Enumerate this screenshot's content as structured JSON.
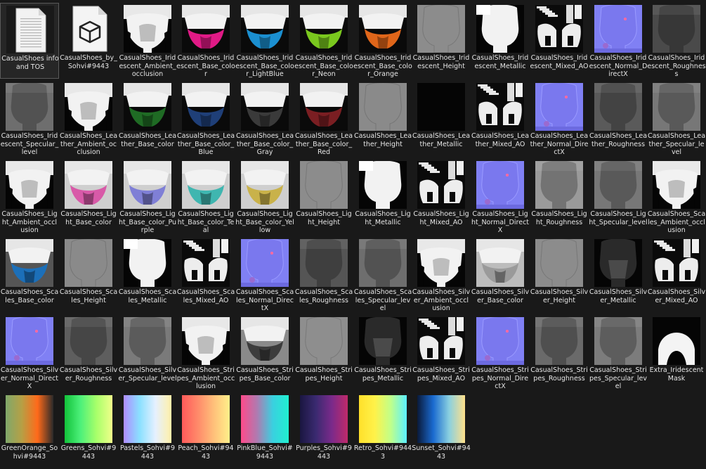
{
  "explorer": {
    "items": [
      {
        "name": "CasualShoes info and TOS",
        "thumb": "document-icon"
      },
      {
        "name": "CasualShoes_by_Sohvi#9443",
        "thumb": "3d-object-icon"
      },
      {
        "name": "CasualShoes_Iridescent_Ambient_occlusion",
        "thumb": "ao"
      },
      {
        "name": "CasualShoes_Iridescent_Base_color",
        "thumb": "base",
        "color": "#e01a86"
      },
      {
        "name": "CasualShoes_Iridescent_Base_color_LightBlue",
        "thumb": "base",
        "color": "#1b8fd0"
      },
      {
        "name": "CasualShoes_Iridescent_Base_color_Neon",
        "thumb": "base",
        "color": "#7ac81e"
      },
      {
        "name": "CasualShoes_Iridescent_Base_color_Orange",
        "thumb": "base",
        "color": "#e0661a"
      },
      {
        "name": "CasualShoes_Iridescent_Height",
        "thumb": "flat",
        "color": "#8c8c8c"
      },
      {
        "name": "CasualShoes_Iridescent_Metallic",
        "thumb": "metallic"
      },
      {
        "name": "CasualShoes_Iridescent_Mixed_AO",
        "thumb": "mixed"
      },
      {
        "name": "CasualShoes_Iridescent_Normal_DirectX",
        "thumb": "normal"
      },
      {
        "name": "CasualShoes_Iridescent_Roughness",
        "thumb": "gray",
        "color": "#4a4a4a"
      },
      {
        "name": "CasualShoes_Iridescent_Specular_level",
        "thumb": "gray",
        "color": "#6e6e6e"
      },
      {
        "name": "CasualShoes_Leather_Ambient_occlusion",
        "thumb": "ao"
      },
      {
        "name": "CasualShoes_Leather_Base_color",
        "thumb": "base",
        "color": "#1f6b24"
      },
      {
        "name": "CasualShoes_Leather_Base_color_Blue",
        "thumb": "base",
        "color": "#1f3f78"
      },
      {
        "name": "CasualShoes_Leather_Base_color_Gray",
        "thumb": "base",
        "color": "#3a3a3a"
      },
      {
        "name": "CasualShoes_Leather_Base_color_Red",
        "thumb": "base",
        "color": "#7a1e22"
      },
      {
        "name": "CasualShoes_Leather_Height",
        "thumb": "flat",
        "color": "#8a8a8a"
      },
      {
        "name": "CasualShoes_Leather_Metallic",
        "thumb": "black"
      },
      {
        "name": "CasualShoes_Leather_Mixed_AO",
        "thumb": "mixed"
      },
      {
        "name": "CasualShoes_Leather_Normal_DirectX",
        "thumb": "normal"
      },
      {
        "name": "CasualShoes_Leather_Roughness",
        "thumb": "gray",
        "color": "#5a5a5a"
      },
      {
        "name": "CasualShoes_Leather_Specular_level",
        "thumb": "gray",
        "color": "#777777"
      },
      {
        "name": "CasualShoes_Light_Ambient_occlusion",
        "thumb": "ao"
      },
      {
        "name": "CasualShoes_Light_Base_color",
        "thumb": "base",
        "color": "#d85aa8",
        "bg": "#cfcfcf"
      },
      {
        "name": "CasualShoes_Light_Base_color_Purple",
        "thumb": "base",
        "color": "#7f7fd6",
        "bg": "#cfcfcf"
      },
      {
        "name": "CasualShoes_Light_Base_color_Teal",
        "thumb": "base",
        "color": "#3fb6b0",
        "bg": "#cfcfcf"
      },
      {
        "name": "CasualShoes_Light_Base_color_Yellow",
        "thumb": "base",
        "color": "#c9b24a",
        "bg": "#cfcfcf"
      },
      {
        "name": "CasualShoes_Light_Height",
        "thumb": "flat",
        "color": "#8c8c8c"
      },
      {
        "name": "CasualShoes_Light_Metallic",
        "thumb": "metallic"
      },
      {
        "name": "CasualShoes_Light_Mixed_AO",
        "thumb": "mixed"
      },
      {
        "name": "CasualShoes_Light_Normal_DirectX",
        "thumb": "normal"
      },
      {
        "name": "CasualShoes_Light_Roughness",
        "thumb": "gray",
        "color": "#9a9a9a"
      },
      {
        "name": "CasualShoes_Light_Specular_level",
        "thumb": "gray",
        "color": "#777777"
      },
      {
        "name": "CasualShoes_Scales_Ambient_occlusion",
        "thumb": "ao"
      },
      {
        "name": "CasualShoes_Scales_Base_color",
        "thumb": "base",
        "color": "#1c6fb8",
        "bg": "#555555"
      },
      {
        "name": "CasualShoes_Scales_Height",
        "thumb": "flat",
        "color": "#8a8a8a"
      },
      {
        "name": "CasualShoes_Scales_Metallic",
        "thumb": "metallic"
      },
      {
        "name": "CasualShoes_Scales_Mixed_AO",
        "thumb": "mixed"
      },
      {
        "name": "CasualShoes_Scales_Normal_DirectX",
        "thumb": "normal"
      },
      {
        "name": "CasualShoes_Scales_Roughness",
        "thumb": "gray",
        "color": "#555555"
      },
      {
        "name": "CasualShoes_Scales_Specular_level",
        "thumb": "gray",
        "color": "#6e6e6e"
      },
      {
        "name": "CasualShoes_Silver_Ambient_occlusion",
        "thumb": "ao"
      },
      {
        "name": "CasualShoes_Silver_Base_color",
        "thumb": "base",
        "color": "#9a9a9a",
        "bg": "#bcbcbc"
      },
      {
        "name": "CasualShoes_Silver_Height",
        "thumb": "flat",
        "color": "#8c8c8c"
      },
      {
        "name": "CasualShoes_Silver_Metallic",
        "thumb": "metallic-dark"
      },
      {
        "name": "CasualShoes_Silver_Mixed_AO",
        "thumb": "mixed"
      },
      {
        "name": "CasualShoes_Silver_Normal_DirectX",
        "thumb": "normal"
      },
      {
        "name": "CasualShoes_Silver_Roughness",
        "thumb": "gray",
        "color": "#5e5e5e"
      },
      {
        "name": "CasualShoes_Silver_Specular_level",
        "thumb": "gray",
        "color": "#7a7a7a"
      },
      {
        "name": "CasualShoes_Stripes_Ambient_occlusion",
        "thumb": "ao"
      },
      {
        "name": "CasualShoes_Stripes_Base_color",
        "thumb": "base",
        "color": "#3c3c3c",
        "bg": "#8a8a8a"
      },
      {
        "name": "CasualShoes_Stripes_Height",
        "thumb": "flat",
        "color": "#8e8e8e"
      },
      {
        "name": "CasualShoes_Stripes_Metallic",
        "thumb": "metallic-dark"
      },
      {
        "name": "CasualShoes_Stripes_Mixed_AO",
        "thumb": "mixed"
      },
      {
        "name": "CasualShoes_Stripes_Normal_DirectX",
        "thumb": "normal"
      },
      {
        "name": "CasualShoes_Stripes_Roughness",
        "thumb": "gray",
        "color": "#6a6a6a"
      },
      {
        "name": "CasualShoes_Stripes_Specular_level",
        "thumb": "gray",
        "color": "#7c7c7c"
      },
      {
        "name": "Extra_Iridescent Mask",
        "thumb": "mask"
      },
      {
        "name": "GreenOrange_Sohvi#9443",
        "thumb": "gradient",
        "colors": [
          "#7fa86b",
          "#b5a046",
          "#ff6a1a",
          "#2a2a2a"
        ]
      },
      {
        "name": "Greens_Sohvi#9443",
        "thumb": "gradient",
        "colors": [
          "#12c23a",
          "#4df07a",
          "#a8ff6a",
          "#f0ff8a"
        ]
      },
      {
        "name": "Pastels_Sohvi#9443",
        "thumb": "gradient",
        "colors": [
          "#b08cff",
          "#8ae0ff",
          "#e6f0ff",
          "#fff0a8"
        ]
      },
      {
        "name": "Peach_Sohvi#9443",
        "thumb": "gradient",
        "colors": [
          "#ff5a5a",
          "#ff8a6a",
          "#ffc07a",
          "#fff08a"
        ]
      },
      {
        "name": "PinkBlue_Sohvi#9443",
        "thumb": "gradient",
        "colors": [
          "#ff4a8a",
          "#b07ab0",
          "#3ad0e0",
          "#20f0d0"
        ]
      },
      {
        "name": "Purples_Sohvi#9443",
        "thumb": "gradient",
        "colors": [
          "#1a1640",
          "#3a2a70",
          "#7a2a8a",
          "#c02a6a"
        ]
      },
      {
        "name": "Retro_Sohvi#9443",
        "thumb": "gradient",
        "colors": [
          "#ffe02a",
          "#fff24a",
          "#c0ff8a",
          "#5af0ff"
        ]
      },
      {
        "name": "Sunset_Sohvi#9443",
        "thumb": "gradient",
        "colors": [
          "#0a1a3a",
          "#1a6ad0",
          "#8ad0e0",
          "#ffe08a"
        ]
      }
    ]
  }
}
